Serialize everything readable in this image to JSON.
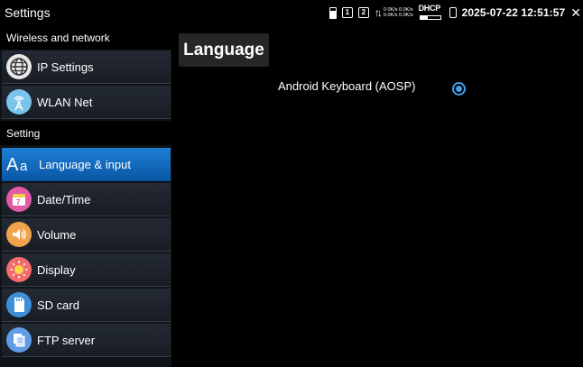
{
  "app": {
    "title": "Settings"
  },
  "status": {
    "icons": [
      "sd-card-icon",
      "number-1-icon",
      "number-2-icon",
      "data-arrows-icon",
      "dhcp-icon",
      "battery-icon",
      "close-icon"
    ],
    "num1": "1",
    "num2": "2",
    "net_up": "0.0K/s 0.0K/s",
    "net_down": "0.0K/s 0.0K/s",
    "dhcp": "DHCP",
    "datetime": "2025-07-22 12:51:57",
    "close": "✕"
  },
  "sidebar": {
    "section1": "Wireless and network",
    "section2": "Setting",
    "items": [
      {
        "label": "IP Settings",
        "icon": "globe-icon",
        "active": false
      },
      {
        "label": "WLAN Net",
        "icon": "wifi-antenna-icon",
        "active": false
      },
      {
        "label": "Language & input",
        "icon": "language-aa-icon",
        "active": true
      },
      {
        "label": "Date/Time",
        "icon": "calendar-icon",
        "active": false
      },
      {
        "label": "Volume",
        "icon": "speaker-icon",
        "active": false
      },
      {
        "label": "Display",
        "icon": "brightness-icon",
        "active": false
      },
      {
        "label": "SD card",
        "icon": "sd-card-icon",
        "active": false
      },
      {
        "label": "FTP server",
        "icon": "ftp-server-icon",
        "active": false
      }
    ]
  },
  "main": {
    "title": "Language",
    "option": {
      "label": "Android Keyboard (AOSP)",
      "selected": true
    }
  },
  "colors": {
    "accent": "#1e7fd4",
    "radio": "#3aa0f0",
    "sidebar_bg": "#0f1419"
  }
}
